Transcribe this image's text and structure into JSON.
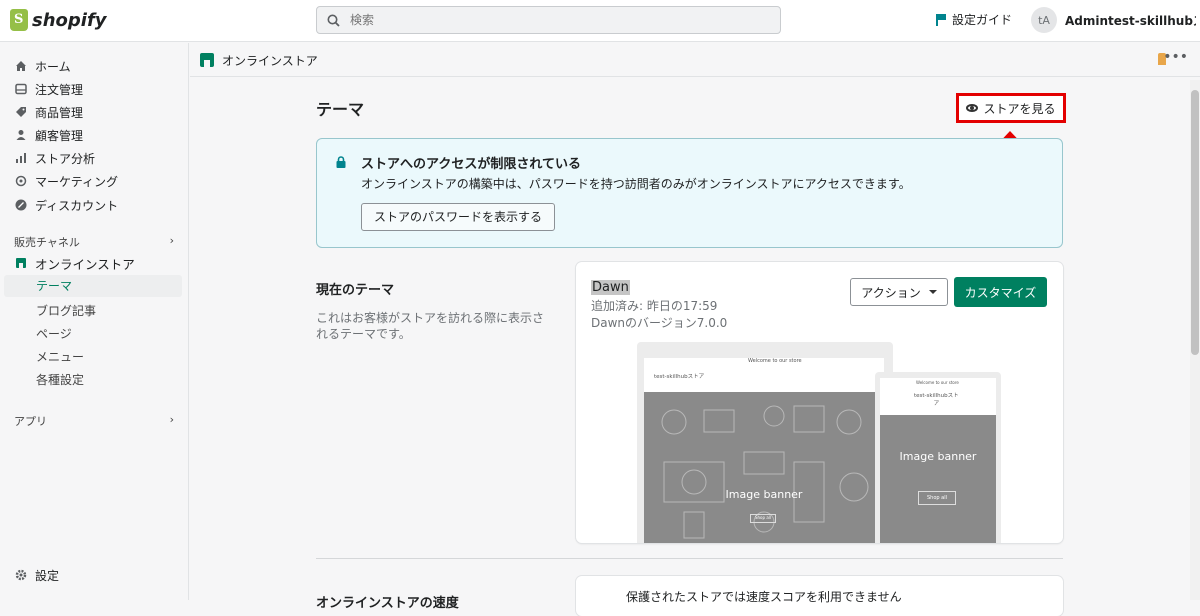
{
  "topbar": {
    "logo_text": "shopify",
    "search_placeholder": "検索",
    "setup_guide": "設定ガイド",
    "avatar_initials": "tA",
    "account_name": "Admintest-skillhubスト..."
  },
  "sidebar": {
    "items": [
      {
        "label": "ホーム",
        "icon": "home-icon"
      },
      {
        "label": "注文管理",
        "icon": "orders-icon"
      },
      {
        "label": "商品管理",
        "icon": "tag-icon"
      },
      {
        "label": "顧客管理",
        "icon": "person-icon"
      },
      {
        "label": "ストア分析",
        "icon": "bar-chart-icon"
      },
      {
        "label": "マーケティング",
        "icon": "target-icon"
      },
      {
        "label": "ディスカウント",
        "icon": "discount-icon"
      }
    ],
    "sales_channels_label": "販売チャネル",
    "online_store_label": "オンラインストア",
    "sub_items": [
      "テーマ",
      "ブログ記事",
      "ページ",
      "メニュー",
      "各種設定"
    ],
    "apps_label": "アプリ",
    "settings_label": "設定"
  },
  "pagebar": {
    "title": "オンラインストア"
  },
  "main": {
    "page_title": "テーマ",
    "view_store_label": "ストアを見る",
    "banner": {
      "title": "ストアへのアクセスが制限されている",
      "text": "オンラインストアの構築中は、パスワードを持つ訪問者のみがオンラインストアにアクセスできます。",
      "button": "ストアのパスワードを表示する"
    },
    "current_theme": {
      "section_title": "現在のテーマ",
      "section_desc": "これはお客様がストアを訪れる際に表示されるテーマです。",
      "name": "Dawn",
      "added": "追加済み: 昨日の17:59",
      "version": "Dawnのバージョン7.0.0",
      "action_label": "アクション",
      "customize_label": "カスタマイズ",
      "preview_desktop_store": "test-skillhubストア",
      "preview_mobile_store": "test-skillhubスト\nア",
      "preview_banner": "Image banner",
      "preview_welcome": "Welcome to our store",
      "preview_shop": "Shop all"
    },
    "bottom_title": "オンラインストアの速度",
    "bottom_text": "保護されたストアでは速度スコアを利用できません"
  },
  "colors": {
    "accent": "#008060",
    "highlight": "#e30000",
    "banner_bg": "#ebf9fc"
  }
}
